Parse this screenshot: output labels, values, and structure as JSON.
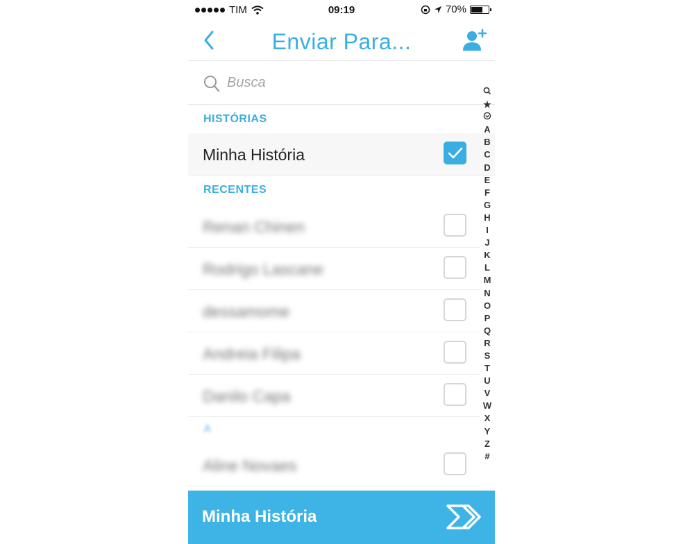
{
  "status_bar": {
    "carrier": "TIM",
    "time": "09:19",
    "battery": "70%",
    "battery_level": 0.7
  },
  "nav": {
    "title": "Enviar Para...",
    "back_icon": "chevron-left-icon",
    "add_icon": "add-friend-icon"
  },
  "search": {
    "placeholder": "Busca"
  },
  "sections": {
    "stories_header": "HISTÓRIAS",
    "recent_header": "RECENTES",
    "letter_header": "A"
  },
  "stories": [
    {
      "label": "Minha História",
      "checked": true
    }
  ],
  "recent": [
    {
      "label": "Renan Chinen",
      "checked": false
    },
    {
      "label": "Rodrigo Lascane",
      "checked": false
    },
    {
      "label": "dessamome",
      "checked": false
    },
    {
      "label": "Andreia Filipa",
      "checked": false
    },
    {
      "label": "Danilo Capa",
      "checked": false
    }
  ],
  "letter_a": [
    {
      "label": "Aline Novaes",
      "checked": false
    }
  ],
  "index": [
    "A",
    "B",
    "C",
    "D",
    "E",
    "F",
    "G",
    "H",
    "I",
    "J",
    "K",
    "L",
    "M",
    "N",
    "O",
    "P",
    "Q",
    "R",
    "S",
    "T",
    "U",
    "V",
    "W",
    "X",
    "Y",
    "Z",
    "#"
  ],
  "bottom_bar": {
    "label": "Minha História",
    "send_icon": "double-chevron-right-icon",
    "color": "#3db3e6"
  },
  "colors": {
    "accent": "#3aaee0"
  }
}
